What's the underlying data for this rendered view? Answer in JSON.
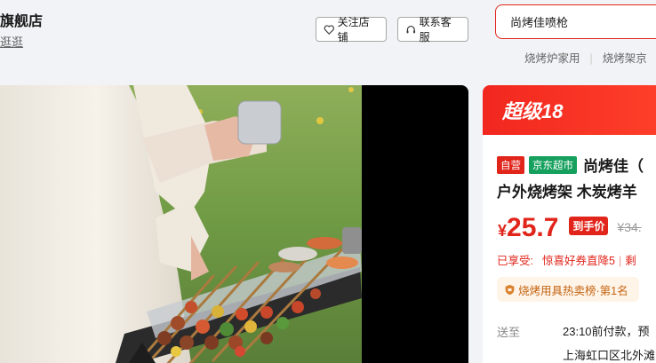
{
  "store": {
    "name": "旗舰店",
    "link": "逛逛"
  },
  "actions": {
    "follow_label": "关注店铺",
    "service_label": "联系客服"
  },
  "search": {
    "value": "尚烤佳喷枪",
    "hot_words": [
      "烧烤炉家用",
      "烧烤架京"
    ]
  },
  "promo": {
    "banner": "超级18",
    "tags": [
      "自营",
      "京东超市"
    ],
    "title_line1": "尚烤佳（",
    "title_line2": "户外烧烤架 木炭烤羊",
    "price_symbol": "¥",
    "price": "25.7",
    "price_badge": "到手价",
    "original_price": "¥34.",
    "enjoy_label": "已享受:",
    "enjoy_item": "惊喜好券直降5",
    "enjoy_more": "剩",
    "rank": "烧烤用具热卖榜·第1名",
    "ship_label": "送至",
    "ship_time": "23:10前付款，预",
    "ship_address": "上海虹口区北外滩"
  },
  "colors": {
    "brand_red": "#e1251b",
    "super_green": "#16a05d",
    "rank_orange": "#c36411"
  }
}
